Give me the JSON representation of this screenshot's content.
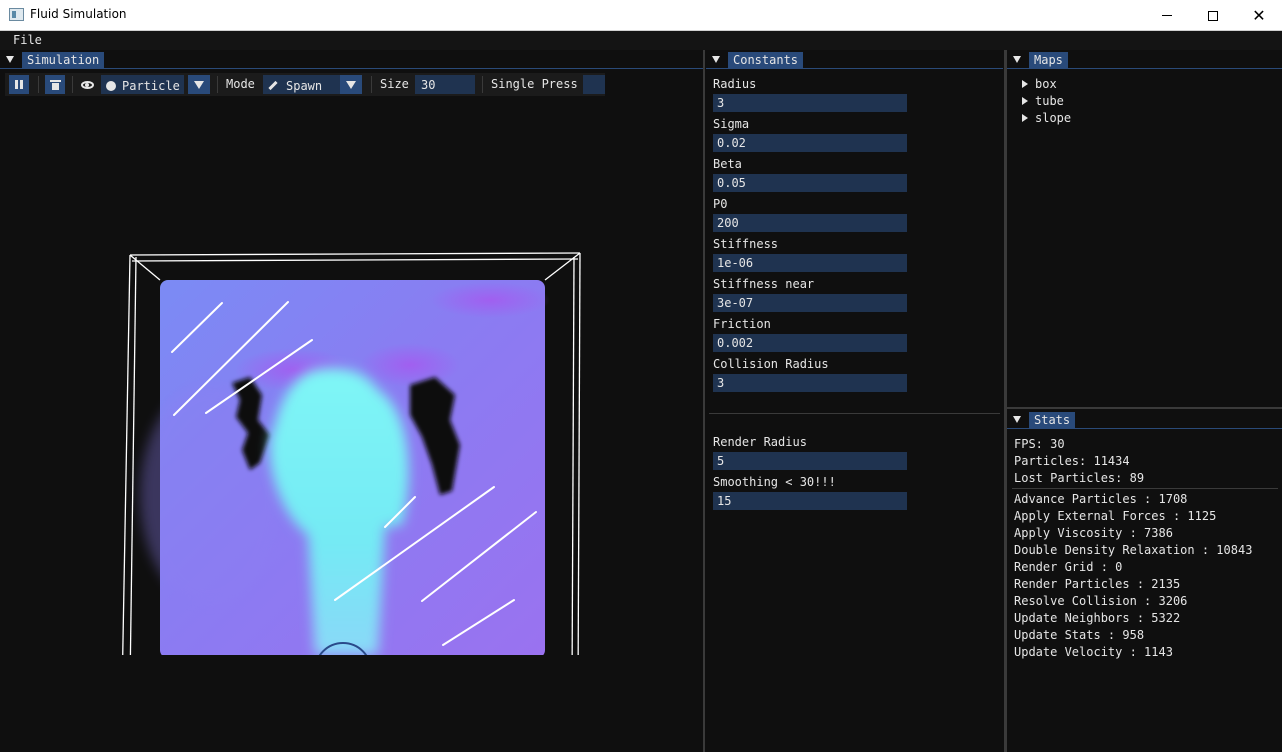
{
  "window": {
    "title": "Fluid Simulation"
  },
  "menu": {
    "items": [
      "File"
    ]
  },
  "simulation_panel": {
    "tab": "Simulation",
    "toolbar": {
      "particle_label": "Particle",
      "mode_label": "Mode",
      "mode_value": "Spawn",
      "size_label": "Size",
      "size_value": "30",
      "single_press_label": "Single Press"
    }
  },
  "constants_panel": {
    "tab": "Constants",
    "fields": [
      {
        "label": "Radius",
        "value": "3"
      },
      {
        "label": "Sigma",
        "value": "0.02"
      },
      {
        "label": "Beta",
        "value": "0.05"
      },
      {
        "label": "P0",
        "value": "200"
      },
      {
        "label": "Stiffness",
        "value": "1e-06"
      },
      {
        "label": "Stiffness near",
        "value": "3e-07"
      },
      {
        "label": "Friction",
        "value": "0.002"
      },
      {
        "label": "Collision Radius",
        "value": "3"
      }
    ],
    "render_fields": [
      {
        "label": "Render Radius",
        "value": "5"
      },
      {
        "label": "Smoothing < 30!!!",
        "value": "15"
      }
    ]
  },
  "maps_panel": {
    "tab": "Maps",
    "items": [
      "box",
      "tube",
      "slope"
    ]
  },
  "stats_panel": {
    "tab": "Stats",
    "summary": [
      "FPS: 30",
      "Particles: 11434",
      "Lost Particles: 89"
    ],
    "timings": [
      "Advance Particles : 1708",
      "Apply External Forces : 1125",
      "Apply Viscosity : 7386",
      "Double Density Relaxation : 10843",
      "Render Grid : 0",
      "Render Particles : 2135",
      "Resolve Collision : 3206",
      "Update Neighbors : 5322",
      "Update Stats : 958",
      "Update Velocity : 1143"
    ]
  },
  "colors": {
    "accent": "#294a7a",
    "field_bg": "#1f3350",
    "fluid_light": "#6ff0f0",
    "fluid_dark": "#8a6ff0"
  }
}
